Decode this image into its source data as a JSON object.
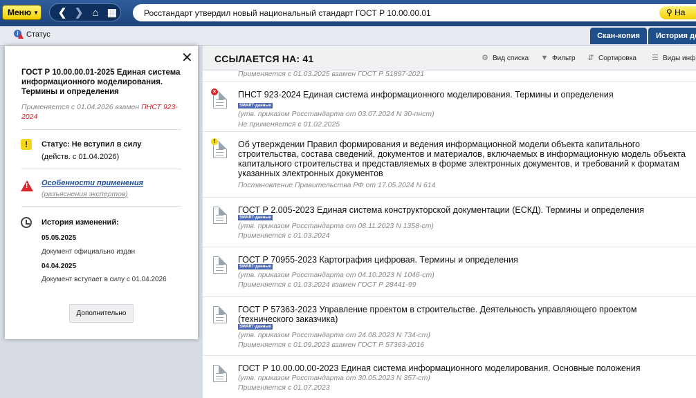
{
  "topbar": {
    "menu_label": "Меню",
    "search_value": "Росстандарт утвердил новый национальный стандарт ГОСТ Р 10.00.00.01",
    "find_label": "На"
  },
  "subbar": {
    "status_label": "Статус",
    "tabs": [
      {
        "label": "Скан-копия"
      },
      {
        "label": "История до"
      }
    ]
  },
  "main": {
    "title": "ССЫЛАЕТСЯ НА: 41",
    "tools": [
      {
        "label": "Вид списка",
        "icon": "gear-icon"
      },
      {
        "label": "Фильтр",
        "icon": "filter-icon"
      },
      {
        "label": "Сортировка",
        "icon": "sort-icon"
      },
      {
        "label": "Виды инф",
        "icon": "list-icon"
      }
    ],
    "top_note": "Применяется с 01.03.2025 взамен ГОСТ Р 51897-2021",
    "smart_label": "SMART-данные",
    "docs": [
      {
        "title": "ПНСТ 923-2024 Единая система информационного моделирования. Термины и определения",
        "approved": "(утв. приказом Росстандарта от 03.07.2024 N 30-пнст)",
        "applies": "Не применяется с 01.02.2025",
        "marker": "x"
      },
      {
        "title": "Об утверждении Правил формирования и ведения информационной модели объекта капитального строительства, состава сведений, документов и материалов, включаемых в информационную модель объекта капитального строительства и представляемых в форме электронных документов, и требований к форматам указанных электронных документов",
        "approved": "Постановление Правительства РФ от 17.05.2024 N 614",
        "marker": "!"
      },
      {
        "title": "ГОСТ Р 2.005-2023 Единая система конструкторской документации (ЕСКД). Термины и определения",
        "approved": "(утв. приказом Росстандарта от 08.11.2023 N 1358-ст)",
        "applies": "Применяется с 01.03.2024"
      },
      {
        "title": "ГОСТ Р 70955-2023 Картография цифровая. Термины и определения",
        "approved": "(утв. приказом Росстандарта от 04.10.2023 N 1046-ст)",
        "applies": "Применяется с 01.03.2024 взамен ГОСТ Р 28441-99"
      },
      {
        "title": "ГОСТ Р 57363-2023 Управление проектом в строительстве. Деятельность управляющего проектом (технического заказчика)",
        "approved": "(утв. приказом Росстандарта от 24.08.2023 N 734-ст)",
        "applies": "Применяется с 01.09.2023 взамен ГОСТ Р 57363-2016"
      },
      {
        "title": "ГОСТ Р 10.00.00.00-2023 Единая система информационного моделирования. Основные положения",
        "approved": "(утв. приказом Росстандарта от 30.05.2023 N 357-ст)",
        "applies": "Применяется с 01.07.2023"
      }
    ]
  },
  "popup": {
    "title": "ГОСТ Р 10.00.00.01-2025 Единая система информационного моделирования. Термины и определения",
    "applies_prefix": "Применяется с 01.04.2026 взамен",
    "applies_link": "ПНСТ 923-2024",
    "status": "Статус: Не вступил в силу",
    "status_sub": "(действ. с 01.04.2026)",
    "features_link": "Особенности применения",
    "features_sub": "(разъяснения экспертов)",
    "history_title": "История изменений:",
    "history": [
      {
        "date": "05.05.2025",
        "event": "Документ официально издан"
      },
      {
        "date": "04.04.2025",
        "event": "Документ вступает в силу с 01.04.2026"
      }
    ],
    "more_label": "Дополнительно"
  }
}
